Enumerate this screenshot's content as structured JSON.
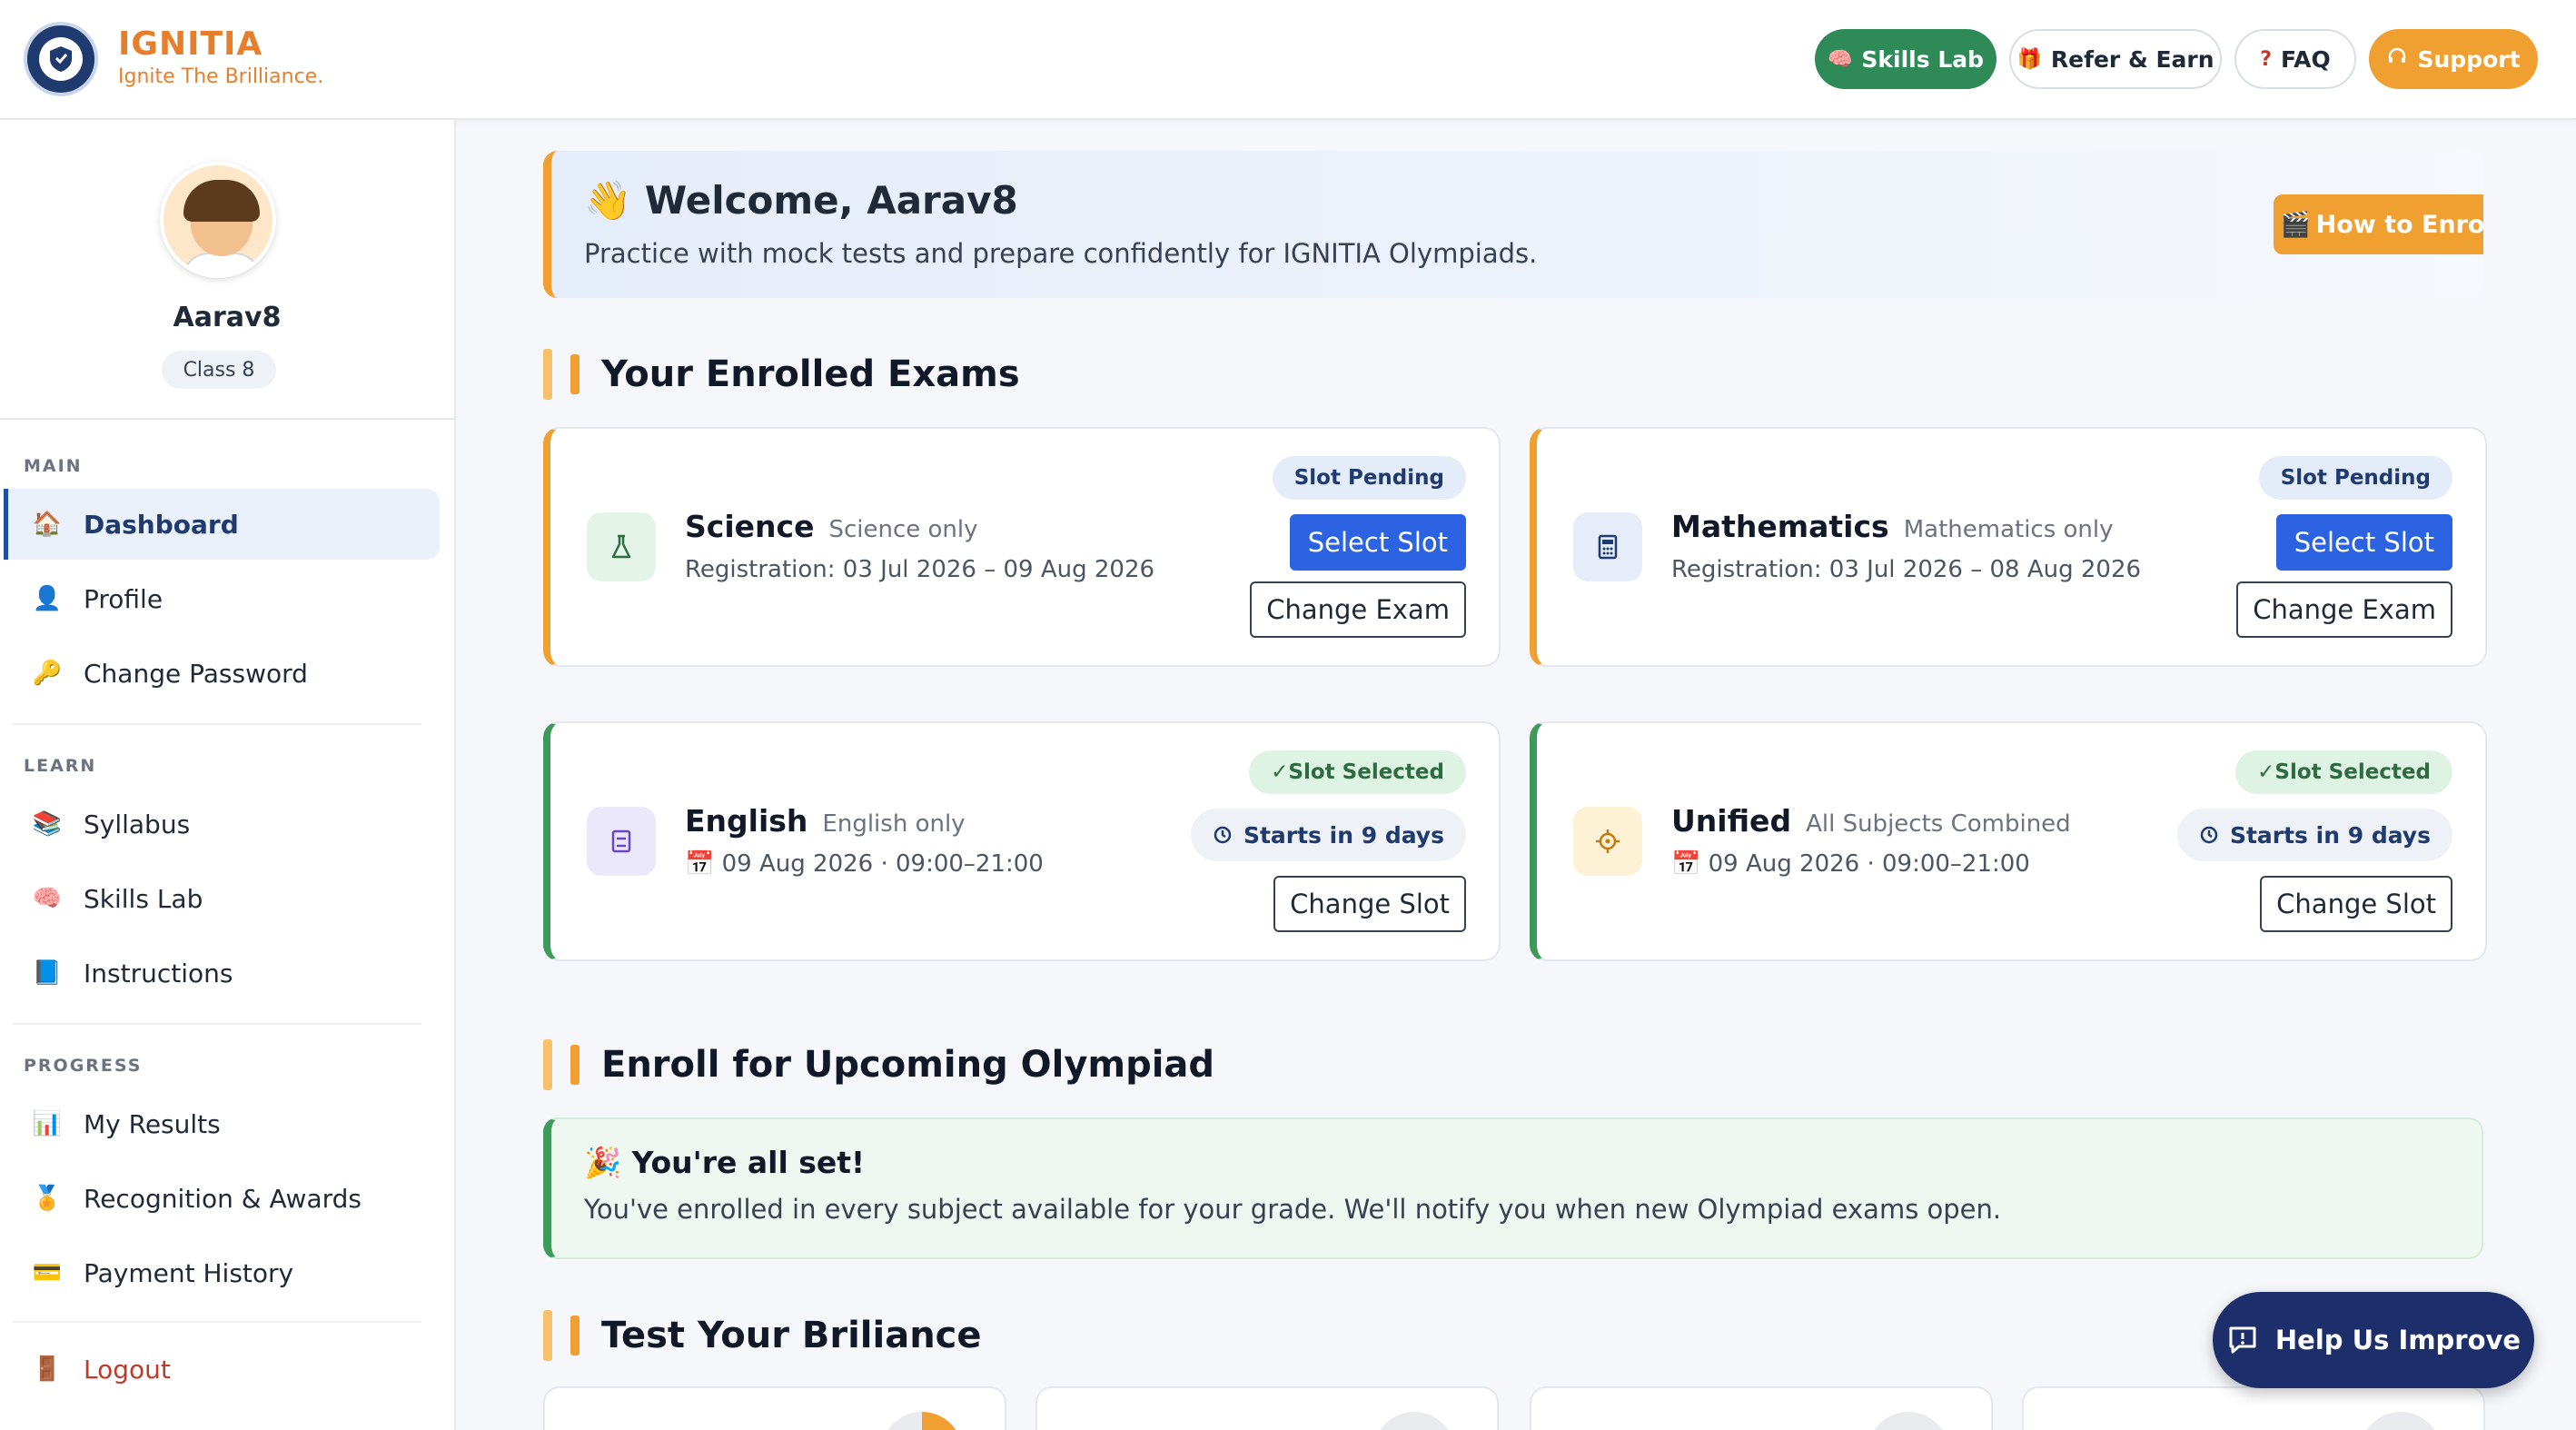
{
  "brand": {
    "name": "IGNITIA",
    "tagline": "Ignite The Brilliance."
  },
  "topnav": {
    "skills_lab": "Skills Lab",
    "refer_earn": "Refer & Earn",
    "faq": "FAQ",
    "support": "Support"
  },
  "user": {
    "name": "Aarav8",
    "class": "Class 8"
  },
  "sidebar": {
    "sections": {
      "main": "MAIN",
      "learn": "LEARN",
      "progress": "PROGRESS"
    },
    "items": [
      {
        "label": "Dashboard",
        "icon": "home-icon"
      },
      {
        "label": "Profile",
        "icon": "user-icon"
      },
      {
        "label": "Change Password",
        "icon": "key-icon"
      },
      {
        "label": "Syllabus",
        "icon": "books-icon"
      },
      {
        "label": "Skills Lab",
        "icon": "brain-icon"
      },
      {
        "label": "Instructions",
        "icon": "book-icon"
      },
      {
        "label": "My Results",
        "icon": "bar-chart-icon"
      },
      {
        "label": "Recognition & Awards",
        "icon": "medal-icon"
      },
      {
        "label": "Payment History",
        "icon": "card-icon"
      },
      {
        "label": "Logout",
        "icon": "door-icon"
      }
    ]
  },
  "welcome": {
    "title": "Welcome, Aarav8",
    "subtitle": "Practice with mock tests and prepare confidently for IGNITIA Olympiads.",
    "how_to_enroll": "How to Enroll"
  },
  "sections": {
    "enrolled": "Your Enrolled Exams",
    "upcoming": "Enroll for Upcoming Olympiad",
    "brilliance": "Test Your Briliance"
  },
  "exams": [
    {
      "name": "Science",
      "scope": "Science only",
      "meta": "Registration: 03 Jul 2026 – 09 Aug 2026",
      "badge": "Slot Pending",
      "primary": "Select Slot",
      "secondary": "Change Exam",
      "icon": "flask-icon"
    },
    {
      "name": "Mathematics",
      "scope": "Mathematics only",
      "meta": "Registration: 03 Jul 2026 – 08 Aug 2026",
      "badge": "Slot Pending",
      "primary": "Select Slot",
      "secondary": "Change Exam",
      "icon": "calculator-icon"
    },
    {
      "name": "English",
      "scope": "English only",
      "meta": "09 Aug 2026 · 09:00–21:00",
      "badge": "✓Slot Selected",
      "primary": "Starts in 9 days",
      "secondary": "Change Slot",
      "icon": "notebook-icon"
    },
    {
      "name": "Unified",
      "scope": "All Subjects Combined",
      "meta": "09 Aug 2026 · 09:00–21:00",
      "badge": "✓Slot Selected",
      "primary": "Starts in 9 days",
      "secondary": "Change Slot",
      "icon": "target-icon"
    }
  ],
  "allset": {
    "title": "You're all set!",
    "message": "You've enrolled in every subject available for your grade. We'll notify you when new Olympiad exams open."
  },
  "help": {
    "label": "Help Us Improve"
  },
  "colors": {
    "brand_orange": "#f0a030",
    "navy": "#1c2f6b",
    "green": "#2e8a57",
    "blue": "#2b63e3"
  }
}
